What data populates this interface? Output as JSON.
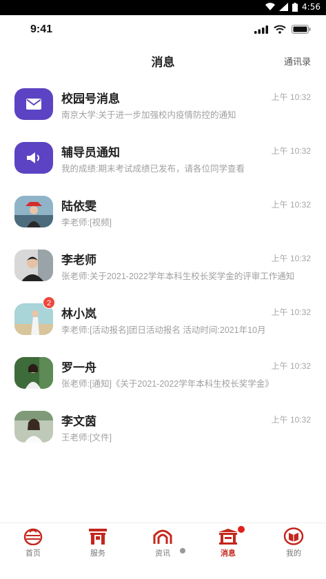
{
  "system": {
    "clock": "4:56"
  },
  "ios": {
    "time": "9:41"
  },
  "header": {
    "title": "消息",
    "contacts_label": "通讯录"
  },
  "messages": [
    {
      "name": "校园号消息",
      "time": "上午 10:32",
      "preview": "南京大学:关于进一步加强校内疫情防控的通知",
      "avatar": "mail-icon"
    },
    {
      "name": "辅导员通知",
      "time": "上午 10:32",
      "preview": "我的成绩:期末考试成绩已发布，请各位同学查看",
      "avatar": "speaker-icon"
    },
    {
      "name": "陆依雯",
      "time": "上午 10:32",
      "preview": "李老师:[视频]",
      "avatar": "photo"
    },
    {
      "name": "李老师",
      "time": "上午 10:32",
      "preview": "张老师:关于2021-2022学年本科生校长奖学金的评审工作通知",
      "avatar": "photo"
    },
    {
      "name": "林小岚",
      "time": "上午 10:32",
      "preview": "李老师:[活动报名]团日活动报名 活动时间:2021年10月",
      "avatar": "photo",
      "badge": "2"
    },
    {
      "name": "罗一舟",
      "time": "上午 10:32",
      "preview": "张老师:[通知]《关于2021-2022学年本科生校长奖学金》",
      "avatar": "photo"
    },
    {
      "name": "李文茵",
      "time": "上午 10:32",
      "preview": "王老师:[文件]",
      "avatar": "photo"
    }
  ],
  "tabs": [
    {
      "label": "首页",
      "icon": "home-icon"
    },
    {
      "label": "服务",
      "icon": "gate-icon"
    },
    {
      "label": "资讯",
      "icon": "arch-icon"
    },
    {
      "label": "消息",
      "icon": "pavilion-icon",
      "active": true
    },
    {
      "label": "我的",
      "icon": "book-icon"
    }
  ],
  "colors": {
    "accent": "#c4261d",
    "purple": "#5b43c3",
    "badge": "#f0463c"
  }
}
